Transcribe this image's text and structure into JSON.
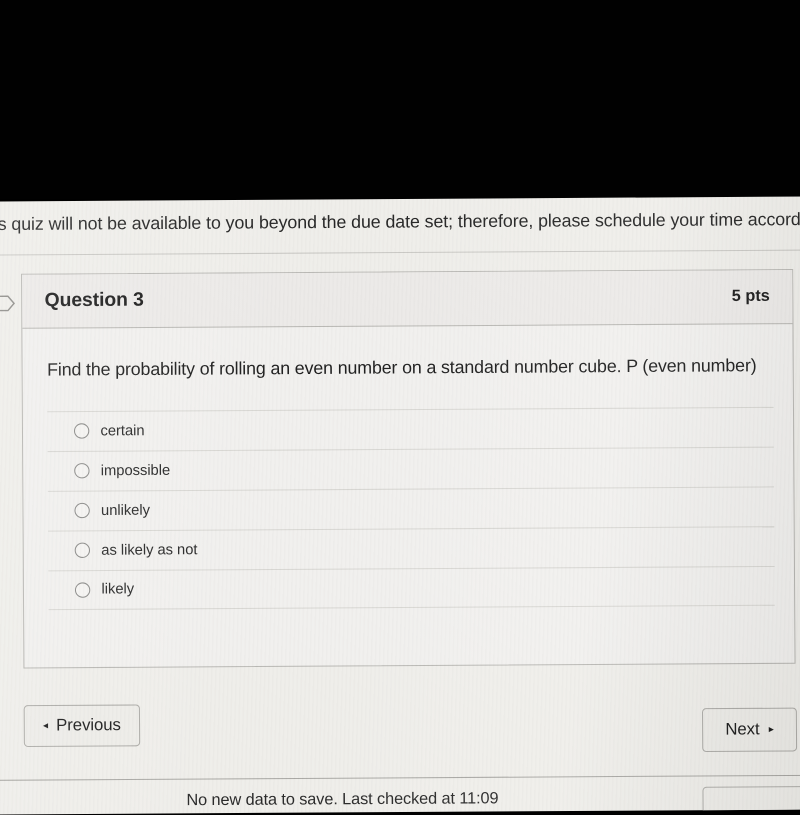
{
  "photo": {
    "black_band_label": "black-screen-area"
  },
  "notice": {
    "text": "his quiz will not be available to you beyond the due date set; therefore, please schedule your time accordingly"
  },
  "gutter": {
    "flag_icon": "flag-icon"
  },
  "question": {
    "title": "Question 3",
    "points": "5 pts",
    "text": "Find the probability of rolling an even number on a standard number cube.  P (even number)",
    "answers": [
      {
        "label": "certain",
        "selected": false
      },
      {
        "label": "impossible",
        "selected": false
      },
      {
        "label": "unlikely",
        "selected": false
      },
      {
        "label": "as likely as not",
        "selected": false
      },
      {
        "label": "likely",
        "selected": false
      }
    ]
  },
  "navigation": {
    "previous_label": "Previous",
    "next_label": "Next",
    "previous_caret": "◂",
    "next_caret": "▸"
  },
  "footer": {
    "save_status": "No new data to save. Last checked at 11:09"
  },
  "colors": {
    "page_background": "#efeeea",
    "card_background": "#f1f0ee",
    "card_header_background": "#eceae8",
    "card_border": "#b9b8b4",
    "separator": "#d8d7d3",
    "text": "#1f1f1f",
    "black_band": "#010101"
  }
}
